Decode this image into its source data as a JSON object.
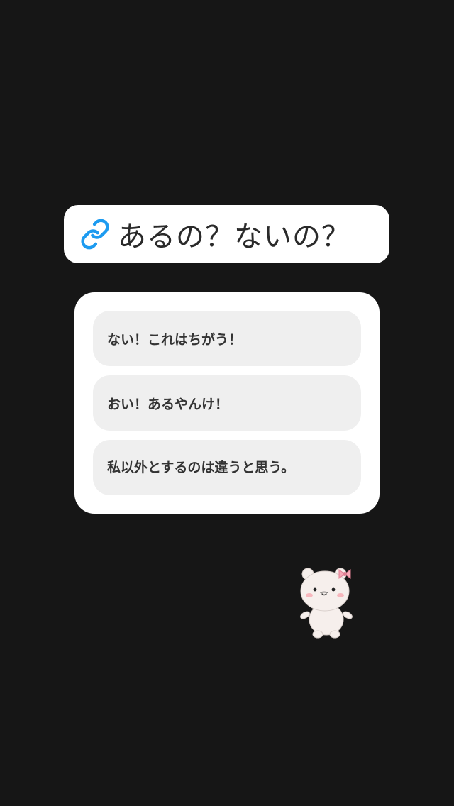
{
  "question": {
    "icon": "link-icon",
    "title": "あるの？ないの？"
  },
  "options": [
    {
      "label": "ない！これはちがう！"
    },
    {
      "label": "おい！あるやんけ！"
    },
    {
      "label": "私以外とするのは違うと思う。"
    }
  ],
  "sticker": {
    "icon": "bear-with-bow-sticker"
  },
  "colors": {
    "background": "#161616",
    "link_accent": "#1d9bf0",
    "option_bg": "#efefef"
  }
}
